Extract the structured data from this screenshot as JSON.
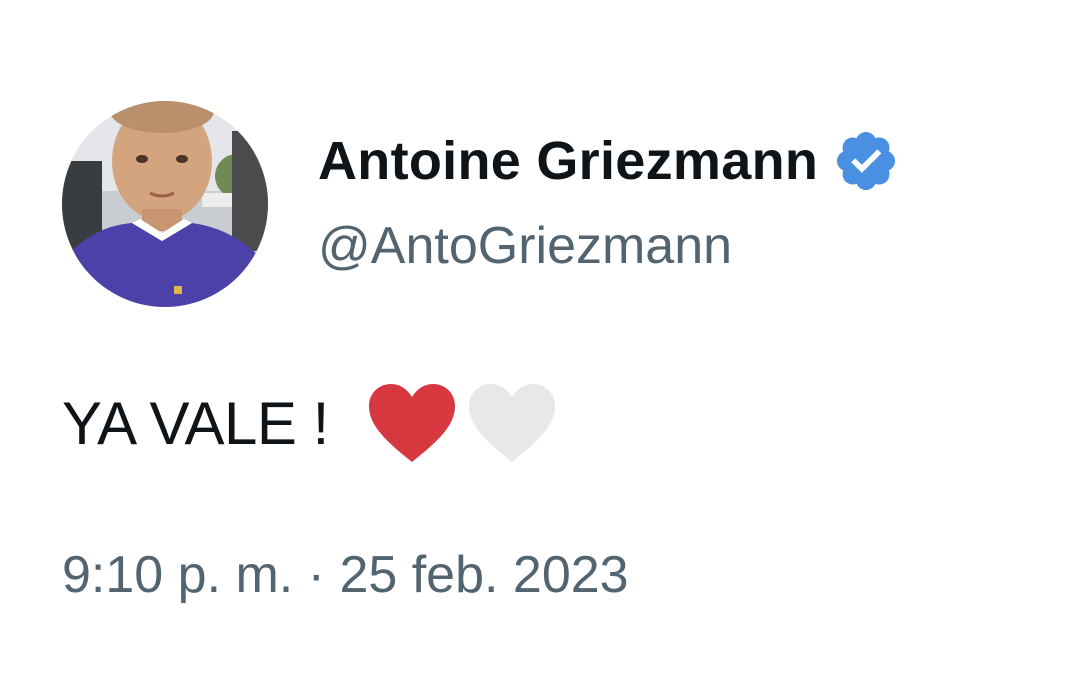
{
  "author": {
    "display_name": "Antoine Griezmann",
    "handle": "@AntoGriezmann",
    "verified": true,
    "avatar_icon": "avatar-photo",
    "verified_icon": "verified-badge-icon",
    "verified_color": "#4a90e2"
  },
  "tweet": {
    "text": "YA VALE !",
    "emojis": [
      "red-heart",
      "white-heart"
    ],
    "timestamp": "9:10 p. m. · 25 feb. 2023"
  },
  "colors": {
    "name": "#0f1419",
    "secondary": "#536471",
    "red_heart": "#d7373f",
    "white_heart": "#e8e8e8"
  }
}
